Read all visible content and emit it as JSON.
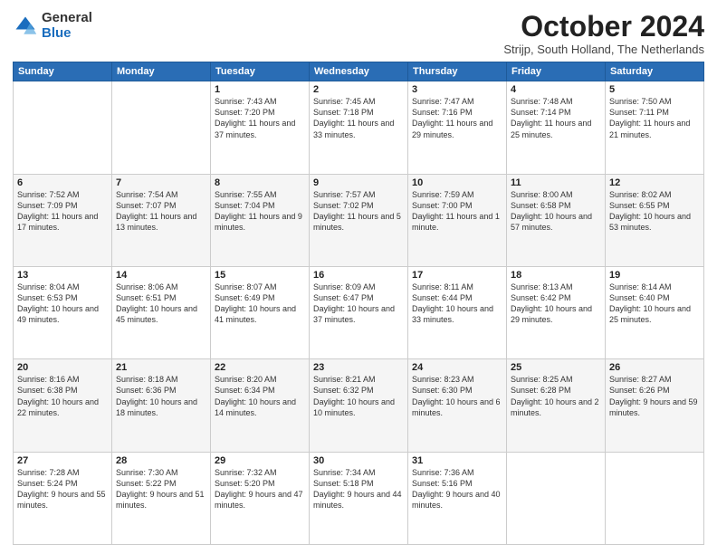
{
  "logo": {
    "general": "General",
    "blue": "Blue"
  },
  "title": "October 2024",
  "location": "Strijp, South Holland, The Netherlands",
  "weekdays": [
    "Sunday",
    "Monday",
    "Tuesday",
    "Wednesday",
    "Thursday",
    "Friday",
    "Saturday"
  ],
  "weeks": [
    [
      {
        "num": "",
        "sunrise": "",
        "sunset": "",
        "daylight": ""
      },
      {
        "num": "",
        "sunrise": "",
        "sunset": "",
        "daylight": ""
      },
      {
        "num": "1",
        "sunrise": "Sunrise: 7:43 AM",
        "sunset": "Sunset: 7:20 PM",
        "daylight": "Daylight: 11 hours and 37 minutes."
      },
      {
        "num": "2",
        "sunrise": "Sunrise: 7:45 AM",
        "sunset": "Sunset: 7:18 PM",
        "daylight": "Daylight: 11 hours and 33 minutes."
      },
      {
        "num": "3",
        "sunrise": "Sunrise: 7:47 AM",
        "sunset": "Sunset: 7:16 PM",
        "daylight": "Daylight: 11 hours and 29 minutes."
      },
      {
        "num": "4",
        "sunrise": "Sunrise: 7:48 AM",
        "sunset": "Sunset: 7:14 PM",
        "daylight": "Daylight: 11 hours and 25 minutes."
      },
      {
        "num": "5",
        "sunrise": "Sunrise: 7:50 AM",
        "sunset": "Sunset: 7:11 PM",
        "daylight": "Daylight: 11 hours and 21 minutes."
      }
    ],
    [
      {
        "num": "6",
        "sunrise": "Sunrise: 7:52 AM",
        "sunset": "Sunset: 7:09 PM",
        "daylight": "Daylight: 11 hours and 17 minutes."
      },
      {
        "num": "7",
        "sunrise": "Sunrise: 7:54 AM",
        "sunset": "Sunset: 7:07 PM",
        "daylight": "Daylight: 11 hours and 13 minutes."
      },
      {
        "num": "8",
        "sunrise": "Sunrise: 7:55 AM",
        "sunset": "Sunset: 7:04 PM",
        "daylight": "Daylight: 11 hours and 9 minutes."
      },
      {
        "num": "9",
        "sunrise": "Sunrise: 7:57 AM",
        "sunset": "Sunset: 7:02 PM",
        "daylight": "Daylight: 11 hours and 5 minutes."
      },
      {
        "num": "10",
        "sunrise": "Sunrise: 7:59 AM",
        "sunset": "Sunset: 7:00 PM",
        "daylight": "Daylight: 11 hours and 1 minute."
      },
      {
        "num": "11",
        "sunrise": "Sunrise: 8:00 AM",
        "sunset": "Sunset: 6:58 PM",
        "daylight": "Daylight: 10 hours and 57 minutes."
      },
      {
        "num": "12",
        "sunrise": "Sunrise: 8:02 AM",
        "sunset": "Sunset: 6:55 PM",
        "daylight": "Daylight: 10 hours and 53 minutes."
      }
    ],
    [
      {
        "num": "13",
        "sunrise": "Sunrise: 8:04 AM",
        "sunset": "Sunset: 6:53 PM",
        "daylight": "Daylight: 10 hours and 49 minutes."
      },
      {
        "num": "14",
        "sunrise": "Sunrise: 8:06 AM",
        "sunset": "Sunset: 6:51 PM",
        "daylight": "Daylight: 10 hours and 45 minutes."
      },
      {
        "num": "15",
        "sunrise": "Sunrise: 8:07 AM",
        "sunset": "Sunset: 6:49 PM",
        "daylight": "Daylight: 10 hours and 41 minutes."
      },
      {
        "num": "16",
        "sunrise": "Sunrise: 8:09 AM",
        "sunset": "Sunset: 6:47 PM",
        "daylight": "Daylight: 10 hours and 37 minutes."
      },
      {
        "num": "17",
        "sunrise": "Sunrise: 8:11 AM",
        "sunset": "Sunset: 6:44 PM",
        "daylight": "Daylight: 10 hours and 33 minutes."
      },
      {
        "num": "18",
        "sunrise": "Sunrise: 8:13 AM",
        "sunset": "Sunset: 6:42 PM",
        "daylight": "Daylight: 10 hours and 29 minutes."
      },
      {
        "num": "19",
        "sunrise": "Sunrise: 8:14 AM",
        "sunset": "Sunset: 6:40 PM",
        "daylight": "Daylight: 10 hours and 25 minutes."
      }
    ],
    [
      {
        "num": "20",
        "sunrise": "Sunrise: 8:16 AM",
        "sunset": "Sunset: 6:38 PM",
        "daylight": "Daylight: 10 hours and 22 minutes."
      },
      {
        "num": "21",
        "sunrise": "Sunrise: 8:18 AM",
        "sunset": "Sunset: 6:36 PM",
        "daylight": "Daylight: 10 hours and 18 minutes."
      },
      {
        "num": "22",
        "sunrise": "Sunrise: 8:20 AM",
        "sunset": "Sunset: 6:34 PM",
        "daylight": "Daylight: 10 hours and 14 minutes."
      },
      {
        "num": "23",
        "sunrise": "Sunrise: 8:21 AM",
        "sunset": "Sunset: 6:32 PM",
        "daylight": "Daylight: 10 hours and 10 minutes."
      },
      {
        "num": "24",
        "sunrise": "Sunrise: 8:23 AM",
        "sunset": "Sunset: 6:30 PM",
        "daylight": "Daylight: 10 hours and 6 minutes."
      },
      {
        "num": "25",
        "sunrise": "Sunrise: 8:25 AM",
        "sunset": "Sunset: 6:28 PM",
        "daylight": "Daylight: 10 hours and 2 minutes."
      },
      {
        "num": "26",
        "sunrise": "Sunrise: 8:27 AM",
        "sunset": "Sunset: 6:26 PM",
        "daylight": "Daylight: 9 hours and 59 minutes."
      }
    ],
    [
      {
        "num": "27",
        "sunrise": "Sunrise: 7:28 AM",
        "sunset": "Sunset: 5:24 PM",
        "daylight": "Daylight: 9 hours and 55 minutes."
      },
      {
        "num": "28",
        "sunrise": "Sunrise: 7:30 AM",
        "sunset": "Sunset: 5:22 PM",
        "daylight": "Daylight: 9 hours and 51 minutes."
      },
      {
        "num": "29",
        "sunrise": "Sunrise: 7:32 AM",
        "sunset": "Sunset: 5:20 PM",
        "daylight": "Daylight: 9 hours and 47 minutes."
      },
      {
        "num": "30",
        "sunrise": "Sunrise: 7:34 AM",
        "sunset": "Sunset: 5:18 PM",
        "daylight": "Daylight: 9 hours and 44 minutes."
      },
      {
        "num": "31",
        "sunrise": "Sunrise: 7:36 AM",
        "sunset": "Sunset: 5:16 PM",
        "daylight": "Daylight: 9 hours and 40 minutes."
      },
      {
        "num": "",
        "sunrise": "",
        "sunset": "",
        "daylight": ""
      },
      {
        "num": "",
        "sunrise": "",
        "sunset": "",
        "daylight": ""
      }
    ]
  ]
}
